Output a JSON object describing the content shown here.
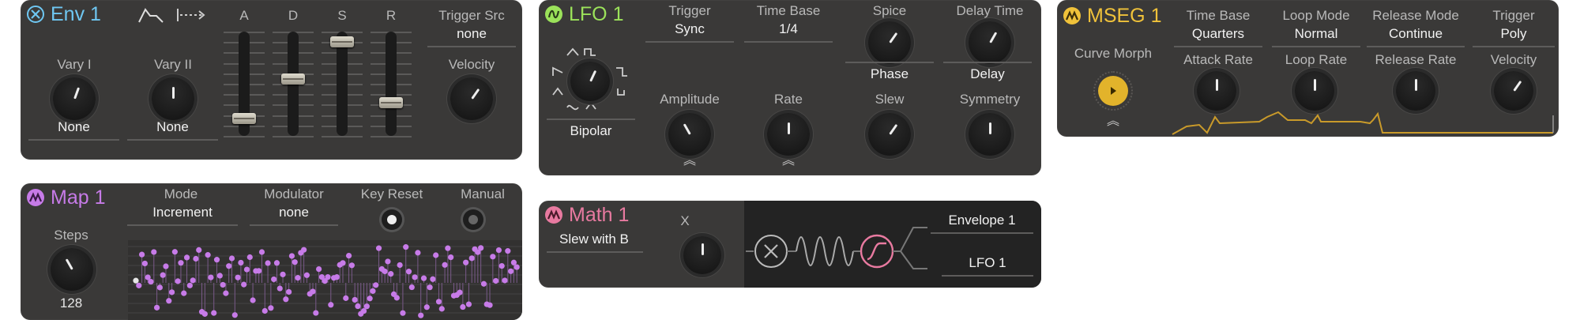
{
  "env": {
    "title": "Env 1",
    "accent": "#6fc7f2",
    "fader_labels": [
      "A",
      "D",
      "S",
      "R"
    ],
    "fader_levels": [
      0.13,
      0.55,
      0.95,
      0.3
    ],
    "vary1": {
      "label": "Vary I",
      "value": "None"
    },
    "vary2": {
      "label": "Vary II",
      "value": "None"
    },
    "trigger_src": {
      "label": "Trigger Src",
      "value": "none"
    },
    "velocity": {
      "label": "Velocity"
    },
    "icons": [
      "envelope-shape-icon",
      "loop-mode-icon"
    ]
  },
  "lfo": {
    "title": "LFO 1",
    "accent": "#9be25a",
    "trigger": {
      "label": "Trigger",
      "value": "Sync"
    },
    "time_base": {
      "label": "Time Base",
      "value": "1/4"
    },
    "spice": {
      "label": "Spice",
      "value": "Phase"
    },
    "delay_time": {
      "label": "Delay Time",
      "value": "Delay"
    },
    "shape_mode": "Bipolar",
    "amplitude": {
      "label": "Amplitude"
    },
    "rate": {
      "label": "Rate"
    },
    "slew": {
      "label": "Slew"
    },
    "symmetry": {
      "label": "Symmetry"
    }
  },
  "mseg": {
    "title": "MSEG 1",
    "accent": "#f0c23a",
    "time_base": {
      "label": "Time Base",
      "value": "Quarters"
    },
    "loop_mode": {
      "label": "Loop Mode",
      "value": "Normal"
    },
    "release_mode": {
      "label": "Release Mode",
      "value": "Continue"
    },
    "trigger": {
      "label": "Trigger",
      "value": "Poly"
    },
    "curve_morph": {
      "label": "Curve Morph"
    },
    "attack_rate": {
      "label": "Attack Rate"
    },
    "loop_rate": {
      "label": "Loop Rate"
    },
    "release_rate": {
      "label": "Release Rate"
    },
    "velocity": {
      "label": "Velocity"
    }
  },
  "map": {
    "title": "Map 1",
    "accent": "#c77be8",
    "mode": {
      "label": "Mode",
      "value": "Increment"
    },
    "modulator": {
      "label": "Modulator",
      "value": "none"
    },
    "key_reset": {
      "label": "Key Reset",
      "state": "on"
    },
    "manual": {
      "label": "Manual",
      "state": "off"
    },
    "steps": {
      "label": "Steps",
      "value": "128"
    }
  },
  "math": {
    "title": "Math 1",
    "accent": "#e87aa0",
    "operation": "Slew with B",
    "x": {
      "label": "X"
    },
    "input_a": "Envelope 1",
    "input_b": "LFO 1"
  }
}
